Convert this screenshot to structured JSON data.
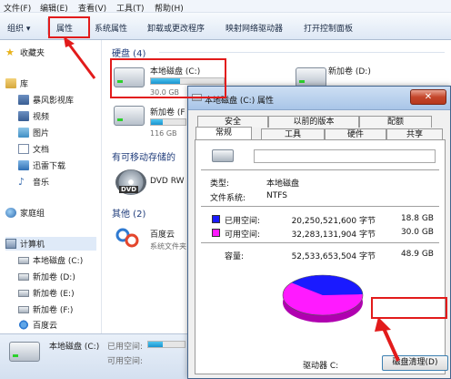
{
  "menubar": [
    "文件(F)",
    "编辑(E)",
    "查看(V)",
    "工具(T)",
    "帮助(H)"
  ],
  "toolbar": {
    "organize": "组织 ▾",
    "properties": "属性",
    "system_properties": "系统属性",
    "uninstall": "卸载或更改程序",
    "map_drive": "映射网络驱动器",
    "control_panel": "打开控制面板"
  },
  "nav": {
    "favorites": "收藏夹",
    "library": "库",
    "library_items": [
      "暴风影视库",
      "视频",
      "图片",
      "文档",
      "迅雷下载",
      "音乐"
    ],
    "homegroup": "家庭组",
    "computer": "计算机",
    "computer_items": [
      "本地磁盘 (C:)",
      "新加卷 (D:)",
      "新加卷 (E:)",
      "新加卷 (F:)",
      "百度云"
    ]
  },
  "content": {
    "group_hdd": "硬盘 (4)",
    "drive_c_name": "本地磁盘 (C:)",
    "drive_c_size": "30.0 GB",
    "drive_c_usage": 0.4,
    "drive_d_name": "新加卷 (D:)",
    "drive_f_name": "新加卷 (F",
    "drive_f_size": "116 GB",
    "drive_f_usage": 0.35,
    "group_removable": "有可移动存储的",
    "dvd_name": "DVD RW",
    "dvd_badge": "DVD",
    "group_other": "其他 (2)",
    "baidu_name": "百度云",
    "baidu_desc": "系统文件夹"
  },
  "status": {
    "drive_name": "本地磁盘 (C:)",
    "used_label": "已用空间:",
    "free_label": "可用空间:",
    "usage": 0.4
  },
  "dialog": {
    "title": "本地磁盘 (C:) 属性",
    "close": "✕",
    "tabs_row1": [
      "安全",
      "以前的版本",
      "配额"
    ],
    "tabs_row2": [
      "常规",
      "工具",
      "硬件",
      "共享"
    ],
    "type_label": "类型:",
    "type_value": "本地磁盘",
    "fs_label": "文件系统:",
    "fs_value": "NTFS",
    "used_label": "已用空间:",
    "used_bytes": "20,250,521,600 字节",
    "used_gb": "18.8 GB",
    "free_label": "可用空间:",
    "free_bytes": "32,283,131,904 字节",
    "free_gb": "30.0 GB",
    "capacity_label": "容量:",
    "capacity_bytes": "52,533,653,504 字节",
    "capacity_gb": "48.9 GB",
    "drive_label": "驱动器 C:",
    "cleanup_button": "磁盘清理(D)",
    "used_fraction": 0.386,
    "used_color": "#1a1aff",
    "free_color": "#ff1aff"
  }
}
